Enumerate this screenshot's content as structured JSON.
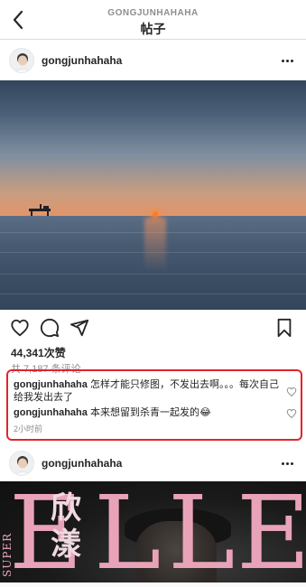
{
  "topbar": {
    "account": "GONGJUNHAHAHA",
    "title": "帖子"
  },
  "post": {
    "username": "gongjunhahaha",
    "likes": "44,341次赞",
    "view_comments": "共 7,187 条评论",
    "time_ago": "2小时前",
    "comments": [
      {
        "user": "gongjunhahaha",
        "text": " 怎样才能只修图，不发出去啊。。。每次自己给我发出去了"
      },
      {
        "user": "gongjunhahaha",
        "text": " 本来想留到杀青一起发的😂"
      }
    ]
  },
  "next_post": {
    "username": "gongjunhahaha",
    "magazine_letters": [
      "E",
      "L",
      "L",
      "E"
    ],
    "side_text": "SUPER",
    "cn_title": "欣漾"
  },
  "colors": {
    "highlight_border": "#e0242d",
    "text_primary": "#262626",
    "text_secondary": "#8e8e8e",
    "elle_pink": "#e9a3b8"
  },
  "icons": [
    "back-icon",
    "more-icon",
    "heart-icon",
    "comment-icon",
    "share-icon",
    "bookmark-icon"
  ]
}
